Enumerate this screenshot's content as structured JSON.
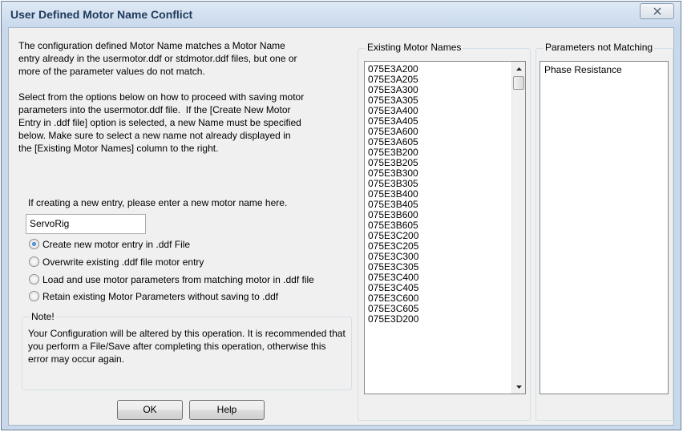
{
  "window": {
    "title": "User Defined Motor Name Conflict"
  },
  "description": "The configuration defined Motor Name matches a Motor Name\nentry already in the usermotor.ddf or stdmotor.ddf files, but one or\nmore of the parameter values do not match.\n\nSelect from the options below on how to proceed with saving motor\nparameters into the usermotor.ddf file.  If the [Create New Motor\nEntry in .ddf file] option is selected, a new Name must be specified\nbelow. Make sure to select a new name not already displayed in\nthe [Existing Motor Names] column to the right.",
  "new_entry": {
    "prompt": "If creating a new entry, please enter a new motor name here.",
    "value": "ServoRig"
  },
  "options": [
    {
      "label": "Create new motor entry in .ddf File",
      "checked": true
    },
    {
      "label": "Overwrite existing .ddf file motor entry",
      "checked": false
    },
    {
      "label": "Load and use motor parameters from matching motor in .ddf file",
      "checked": false
    },
    {
      "label": "Retain existing Motor Parameters without saving to .ddf",
      "checked": false
    }
  ],
  "note": {
    "title": "Note!",
    "text": "Your Configuration will be altered by this operation. It is recommended that you perform a File/Save after completing this operation, otherwise this error may occur again."
  },
  "buttons": {
    "ok": "OK",
    "help": "Help"
  },
  "existing_names": {
    "header": "Existing Motor Names",
    "items": [
      "075E3A200",
      "075E3A205",
      "075E3A300",
      "075E3A305",
      "075E3A400",
      "075E3A405",
      "075E3A600",
      "075E3A605",
      "075E3B200",
      "075E3B205",
      "075E3B300",
      "075E3B305",
      "075E3B400",
      "075E3B405",
      "075E3B600",
      "075E3B605",
      "075E3C200",
      "075E3C205",
      "075E3C300",
      "075E3C305",
      "075E3C400",
      "075E3C405",
      "075E3C600",
      "075E3C605",
      "075E3D200"
    ]
  },
  "params_not_matching": {
    "header": "Parameters not Matching",
    "items": [
      "Phase Resistance"
    ]
  }
}
